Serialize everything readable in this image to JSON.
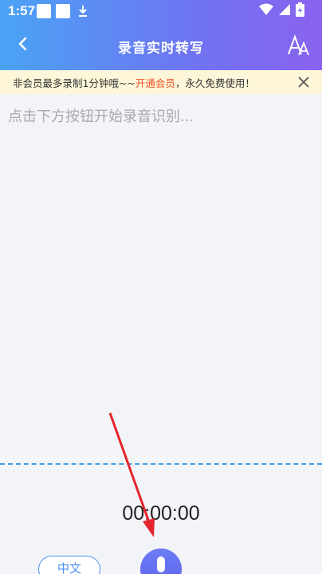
{
  "status_bar": {
    "time": "1:57"
  },
  "app_bar": {
    "title": "录音实时转写",
    "back_icon": "chevron-left-icon",
    "font_icon": "font-size-icon"
  },
  "notice": {
    "text_before": "非会员最多录制1分钟哦~~",
    "link": "开通会员",
    "text_after": "，永久免费使用！"
  },
  "transcript": {
    "placeholder": "点击下方按钮开始录音识别..."
  },
  "recorder": {
    "timer": "00:00:00",
    "language": "中文"
  },
  "colors": {
    "header_start": "#4aa3f5",
    "header_end": "#8a62f0",
    "notice_bg": "#fdf6d8",
    "notice_link": "#f0522a",
    "accent": "#4a8ff0",
    "wave": "#3d9ee8",
    "arrow": "#e5242b"
  }
}
